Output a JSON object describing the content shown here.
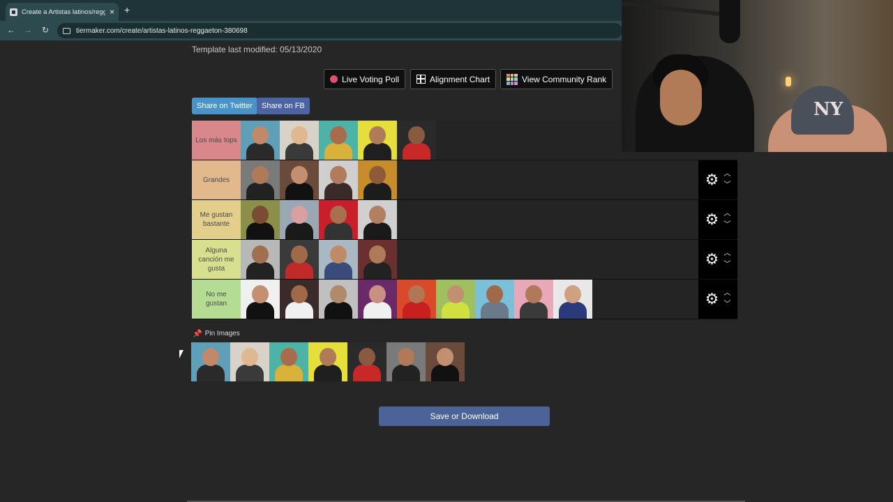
{
  "browser": {
    "tab_title": "Create a Artistas latinos/reggaeton",
    "tab_close": "×",
    "new_tab": "+",
    "url": "tiermaker.com/create/artistas-latinos-reggaeton-380698",
    "back": "←",
    "forward": "→",
    "reload": "↻"
  },
  "page": {
    "template_modified": "Template last modified: 05/13/2020",
    "buttons": {
      "live_voting": "Live Voting Poll",
      "alignment_chart": "Alignment Chart",
      "community_rank": "View Community Rank"
    },
    "share": {
      "twitter": "Share on Twitter",
      "fb": "Share on FB"
    },
    "tiers": [
      {
        "label": "Los más tops",
        "color": "#d8878a",
        "count": 5
      },
      {
        "label": "Grandes",
        "color": "#e2b98c",
        "count": 4
      },
      {
        "label": "Me gustan bastante",
        "color": "#e3ce8c",
        "count": 4
      },
      {
        "label": "Alguna canción me gusta",
        "color": "#d8e08f",
        "count": 4
      },
      {
        "label": "No me gustan",
        "color": "#b4dc93",
        "count": 9
      }
    ],
    "pin_label": "Pin Images",
    "save_button": "Save or Download",
    "icons": {
      "gear": "gear-icon",
      "up": "chevron-up-icon",
      "down": "chevron-down-icon",
      "pin": "pin-icon"
    }
  }
}
